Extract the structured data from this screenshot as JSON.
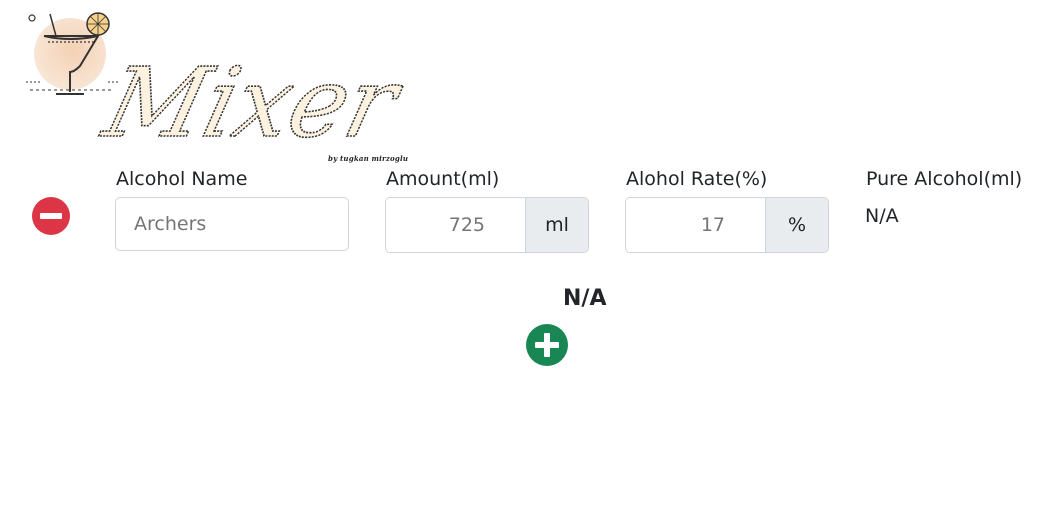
{
  "header": {
    "logo_text": "Mixer",
    "logo_caption": "by tugkan mirzoglu",
    "logo_icon": "cocktail-glass-icon"
  },
  "row": {
    "remove_icon": "minus-circle-icon",
    "remove_color": "#dc3545",
    "name_label": "Alcohol Name",
    "name_value": "Archers",
    "amount_label": "Amount(ml)",
    "amount_value": "725",
    "amount_unit": "ml",
    "rate_label": "Alohol Rate(%)",
    "rate_value": "17",
    "rate_unit": "%",
    "pure_label": "Pure Alcohol(ml)",
    "pure_value": "N/A"
  },
  "total": {
    "value": "N/A"
  },
  "add": {
    "icon": "plus-circle-icon",
    "color": "#198754"
  }
}
